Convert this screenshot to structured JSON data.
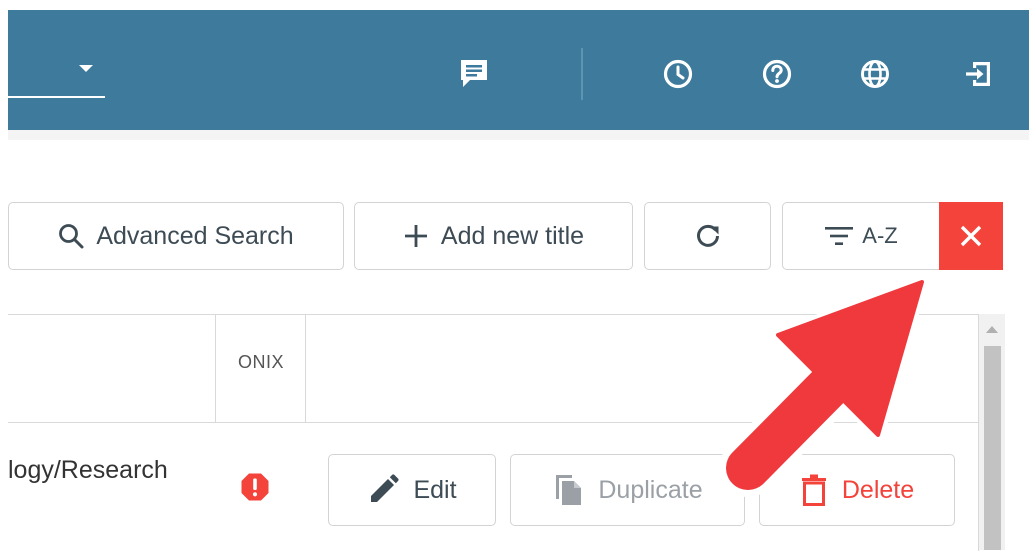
{
  "header": {
    "icons": [
      "chat-icon",
      "history-icon",
      "help-icon",
      "language-icon",
      "logout-icon"
    ]
  },
  "toolbar": {
    "advanced_search_label": "Advanced Search",
    "add_new_title_label": "Add new title",
    "sort_label": "A-Z"
  },
  "table": {
    "columns": [
      "",
      "ONIX",
      ""
    ],
    "rows": [
      {
        "title_text": "logy/Research",
        "onix_status": "error",
        "actions": {
          "edit": "Edit",
          "duplicate": "Duplicate",
          "delete": "Delete"
        }
      }
    ]
  },
  "colors": {
    "header_bg": "#3e7a9b",
    "danger": "#f3433a",
    "primary_text": "#3d4b55",
    "disabled_text": "#9aa0a6"
  }
}
